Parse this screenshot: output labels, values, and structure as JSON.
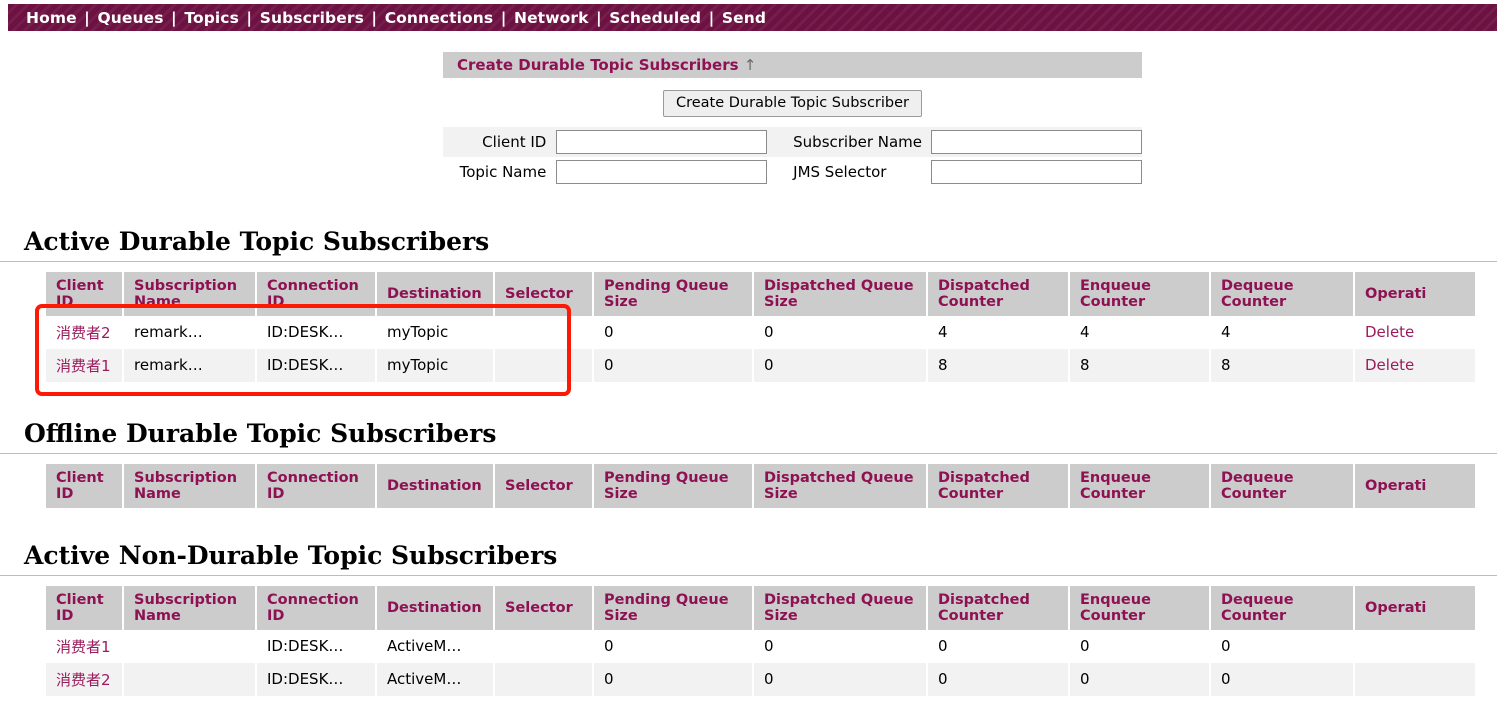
{
  "nav": {
    "items": [
      "Home",
      "Queues",
      "Topics",
      "Subscribers",
      "Connections",
      "Network",
      "Scheduled",
      "Send"
    ],
    "separator": "|"
  },
  "create_panel": {
    "header": "Create Durable Topic Subscribers",
    "header_arrow": "↑",
    "button_label": "Create Durable Topic Subscriber",
    "fields": [
      {
        "label": "Client ID",
        "value": "",
        "placeholder": ""
      },
      {
        "label": "Subscriber Name",
        "value": "",
        "placeholder": ""
      },
      {
        "label": "Topic Name",
        "value": "",
        "placeholder": ""
      },
      {
        "label": "JMS Selector",
        "value": "",
        "placeholder": ""
      }
    ]
  },
  "columns": [
    "Client ID",
    "Subscription Name",
    "Connection ID",
    "Destination",
    "Selector",
    "Pending Queue Size",
    "Dispatched Queue Size",
    "Dispatched Counter",
    "Enqueue Counter",
    "Dequeue Counter",
    "Operati"
  ],
  "sections": [
    {
      "title": "Active Durable Topic Subscribers",
      "rows": [
        {
          "client_id": "消费者2",
          "subscription_name": "remark…",
          "connection_id": "ID:DESK…",
          "destination": "myTopic",
          "selector": "",
          "pending_queue_size": "0",
          "dispatched_queue_size": "0",
          "dispatched_counter": "4",
          "enqueue_counter": "4",
          "dequeue_counter": "4",
          "operation": "Delete"
        },
        {
          "client_id": "消费者1",
          "subscription_name": "remark…",
          "connection_id": "ID:DESK…",
          "destination": "myTopic",
          "selector": "",
          "pending_queue_size": "0",
          "dispatched_queue_size": "0",
          "dispatched_counter": "8",
          "enqueue_counter": "8",
          "dequeue_counter": "8",
          "operation": "Delete"
        }
      ]
    },
    {
      "title": "Offline Durable Topic Subscribers",
      "rows": []
    },
    {
      "title": "Active Non-Durable Topic Subscribers",
      "rows": [
        {
          "client_id": "消费者1",
          "subscription_name": "",
          "connection_id": "ID:DESK…",
          "destination": "ActiveM…",
          "selector": "",
          "pending_queue_size": "0",
          "dispatched_queue_size": "0",
          "dispatched_counter": "0",
          "enqueue_counter": "0",
          "dequeue_counter": "0",
          "operation": ""
        },
        {
          "client_id": "消费者2",
          "subscription_name": "",
          "connection_id": "ID:DESK…",
          "destination": "ActiveM…",
          "selector": "",
          "pending_queue_size": "0",
          "dispatched_queue_size": "0",
          "dispatched_counter": "0",
          "enqueue_counter": "0",
          "dequeue_counter": "0",
          "operation": ""
        }
      ]
    }
  ],
  "colors": {
    "nav_background": "#6c1141",
    "accent_maroon": "#8e1253",
    "link_maroon": "#9b1b5c",
    "header_gray": "#cccccc",
    "row_alt_gray": "#f2f2f2",
    "annotation_red": "#fc1905"
  }
}
